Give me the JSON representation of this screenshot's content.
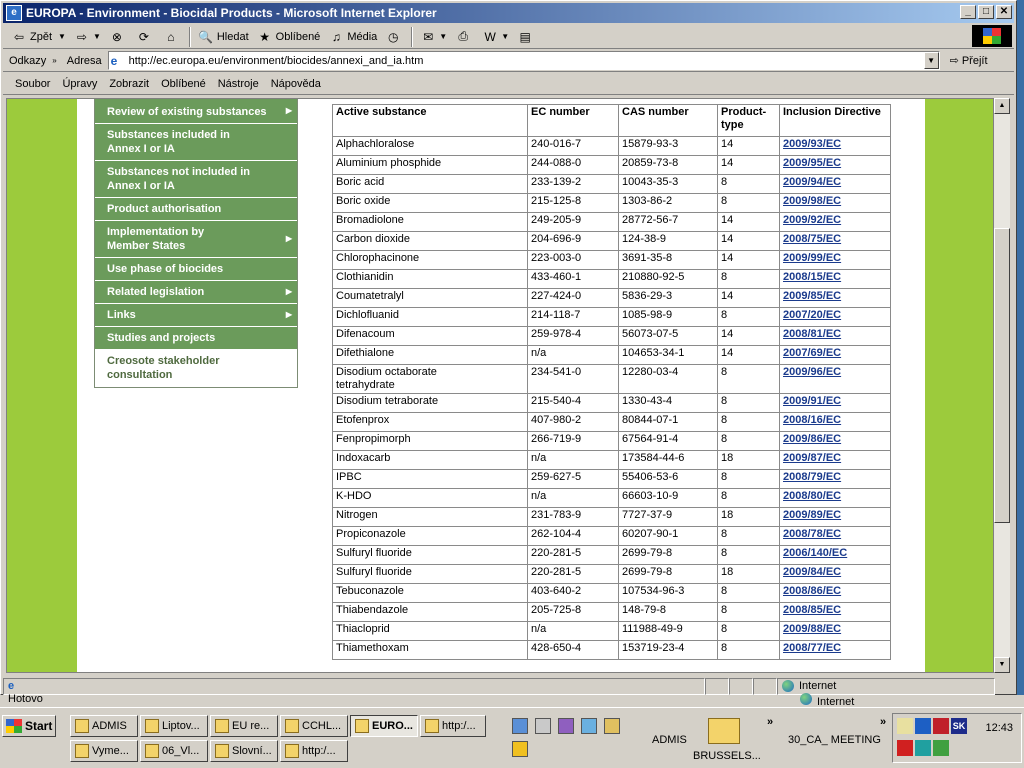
{
  "window": {
    "title": "EUROPA - Environment - Biocidal Products - Microsoft Internet Explorer"
  },
  "toolbar": {
    "back": "Zpět",
    "search": "Hledat",
    "favorites": "Oblíbené",
    "media": "Média"
  },
  "address": {
    "links_label": "Odkazy",
    "address_label": "Adresa",
    "url": "http://ec.europa.eu/environment/biocides/annexi_and_ia.htm",
    "go": "Přejít"
  },
  "menu": [
    "Soubor",
    "Úpravy",
    "Zobrazit",
    "Oblíbené",
    "Nástroje",
    "Nápověda"
  ],
  "nav": [
    {
      "label": "Review of existing substances",
      "arrow": true
    },
    {
      "label": "Substances included in Annex I or IA",
      "arrow": false
    },
    {
      "label": "Substances not included in Annex I or IA",
      "arrow": false
    },
    {
      "label": "Product authorisation",
      "arrow": false
    },
    {
      "label": "Implementation by Member States",
      "arrow": true
    },
    {
      "label": "Use phase of biocides",
      "arrow": false
    },
    {
      "label": "Related legislation",
      "arrow": true
    },
    {
      "label": "Links",
      "arrow": true
    },
    {
      "label": "Studies and projects",
      "arrow": false
    },
    {
      "label": "Creosote stakeholder consultation",
      "arrow": false,
      "active": true
    }
  ],
  "table": {
    "headers": [
      "Active substance",
      "EC number",
      "CAS number",
      "Product-type",
      "Inclusion Directive"
    ],
    "rows": [
      [
        "Alphachloralose",
        "240-016-7",
        "15879-93-3",
        "14",
        "2009/93/EC"
      ],
      [
        "Aluminium phosphide",
        "244-088-0",
        "20859-73-8",
        "14",
        "2009/95/EC"
      ],
      [
        "Boric acid",
        "233-139-2",
        "10043-35-3",
        "8",
        "2009/94/EC"
      ],
      [
        "Boric oxide",
        "215-125-8",
        "1303-86-2",
        "8",
        "2009/98/EC"
      ],
      [
        "Bromadiolone",
        "249-205-9",
        "28772-56-7",
        "14",
        "2009/92/EC"
      ],
      [
        "Carbon dioxide",
        "204-696-9",
        "124-38-9",
        "14",
        "2008/75/EC"
      ],
      [
        "Chlorophacinone",
        "223-003-0",
        "3691-35-8",
        "14",
        "2009/99/EC"
      ],
      [
        "Clothianidin",
        "433-460-1",
        "210880-92-5",
        "8",
        "2008/15/EC"
      ],
      [
        "Coumatetralyl",
        "227-424-0",
        "5836-29-3",
        "14",
        "2009/85/EC"
      ],
      [
        "Dichlofluanid",
        "214-118-7",
        "1085-98-9",
        "8",
        "2007/20/EC"
      ],
      [
        "Difenacoum",
        "259-978-4",
        "56073-07-5",
        "14",
        "2008/81/EC"
      ],
      [
        "Difethialone",
        "n/a",
        "104653-34-1",
        "14",
        "2007/69/EC"
      ],
      [
        "Disodium octaborate tetrahydrate",
        "234-541-0",
        "12280-03-4",
        "8",
        "2009/96/EC"
      ],
      [
        "Disodium tetraborate",
        "215-540-4",
        "1330-43-4",
        "8",
        "2009/91/EC"
      ],
      [
        "Etofenprox",
        "407-980-2",
        "80844-07-1",
        "8",
        "2008/16/EC"
      ],
      [
        "Fenpropimorph",
        "266-719-9",
        "67564-91-4",
        "8",
        "2009/86/EC"
      ],
      [
        "Indoxacarb",
        "n/a",
        "173584-44-6",
        "18",
        "2009/87/EC"
      ],
      [
        "IPBC",
        "259-627-5",
        "55406-53-6",
        "8",
        "2008/79/EC"
      ],
      [
        "K-HDO",
        "n/a",
        "66603-10-9",
        "8",
        "2008/80/EC"
      ],
      [
        "Nitrogen",
        "231-783-9",
        "7727-37-9",
        "18",
        "2009/89/EC"
      ],
      [
        "Propiconazole",
        "262-104-4",
        "60207-90-1",
        "8",
        "2008/78/EC"
      ],
      [
        "Sulfuryl fluoride",
        "220-281-5",
        "2699-79-8",
        "8",
        "2006/140/EC"
      ],
      [
        "Sulfuryl fluoride",
        "220-281-5",
        "2699-79-8",
        "18",
        "2009/84/EC"
      ],
      [
        "Tebuconazole",
        "403-640-2",
        "107534-96-3",
        "8",
        "2008/86/EC"
      ],
      [
        "Thiabendazole",
        "205-725-8",
        "148-79-8",
        "8",
        "2008/85/EC"
      ],
      [
        "Thiacloprid",
        "n/a",
        "111988-49-9",
        "8",
        "2009/88/EC"
      ],
      [
        "Thiamethoxam",
        "428-650-4",
        "153719-23-4",
        "8",
        "2008/77/EC"
      ]
    ]
  },
  "status": {
    "zone": "Internet",
    "under_text": "Hotovo",
    "under_zone": "Internet"
  },
  "taskbar": {
    "start": "Start",
    "tasks_row1": [
      "ADMIS",
      "Liptov...",
      "EU re...",
      "CCHL...",
      "EURO...",
      "http:/..."
    ],
    "tasks_row2": [
      "Vyme...",
      "06_Vl...",
      "Slovní...",
      "http:/..."
    ],
    "group1": [
      "ADMIS",
      "BRUSSELS..."
    ],
    "group2": "30_CA_ MEETING",
    "clock": "12:43",
    "tray_badge": "SK"
  }
}
